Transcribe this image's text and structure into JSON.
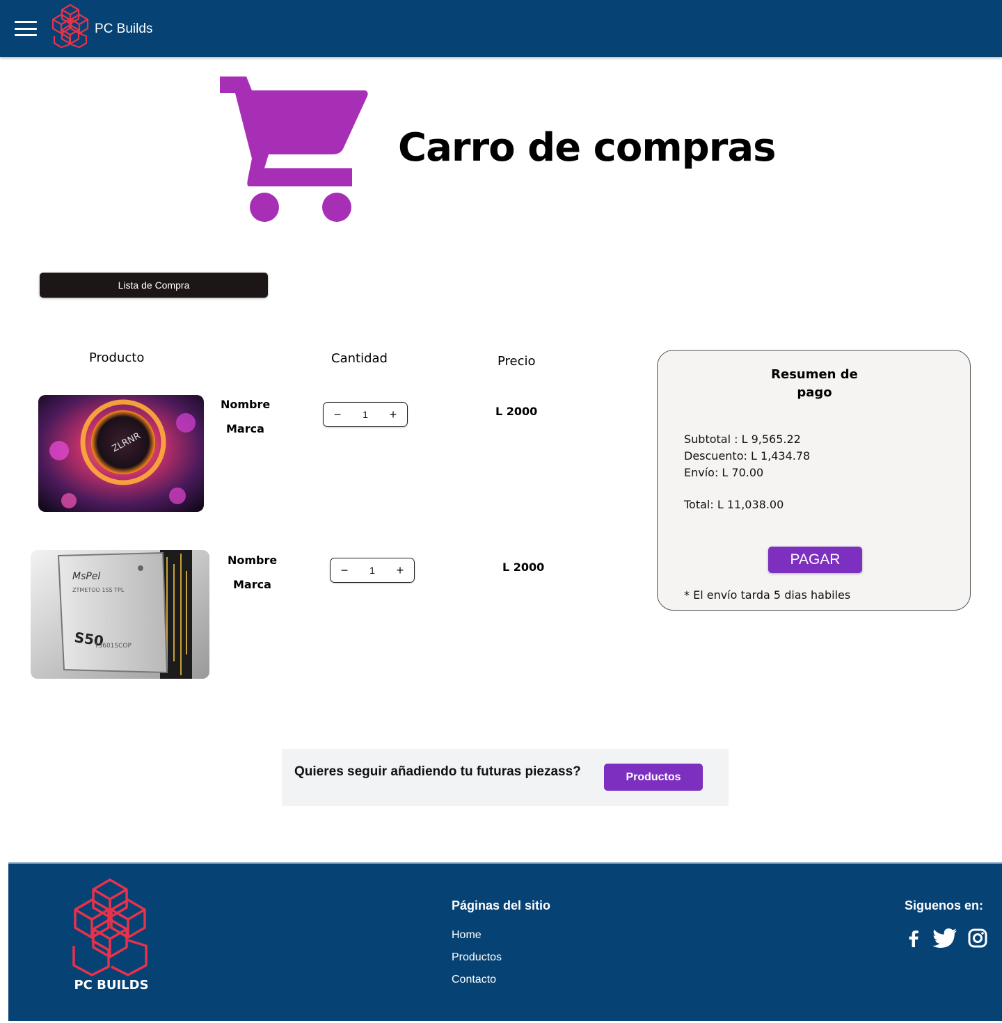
{
  "header": {
    "brand_name": "PC Builds",
    "colors": {
      "bar": "#064273",
      "logo": "#e8324b"
    }
  },
  "hero": {
    "title": "Carro de compras",
    "cart_icon": "shopping-cart-icon",
    "cart_color": "#a72fb6"
  },
  "list_button_label": "Lista de Compra",
  "table": {
    "headers": {
      "product": "Producto",
      "quantity": "Cantidad",
      "price": "Precio"
    },
    "items": [
      {
        "name": "Nombre",
        "brand": "Marca",
        "quantity": "1",
        "price": "L 2000",
        "image": "liquid-cooler-product-image"
      },
      {
        "name": "Nombre",
        "brand": "Marca",
        "quantity": "1",
        "price": "L 2000",
        "image": "ssd-product-image"
      }
    ]
  },
  "summary": {
    "title_line1": "Resumen de",
    "title_line2": "pago",
    "subtotal": "Subtotal : L 9,565.22",
    "discount": "Descuento: L 1,434.78",
    "shipping": "Envío: L 70.00",
    "total": "Total: L 11,038.00",
    "pay_label": "PAGAR",
    "note": "* El envío tarda 5 dias habiles"
  },
  "cta": {
    "text": "Quieres seguir añadiendo tu futuras piezass?",
    "button": "Productos",
    "accent": "#7d2fc0"
  },
  "footer": {
    "logo_text": "PC BUILDS",
    "pages_title": "Páginas del sitio",
    "links": [
      "Home",
      "Productos",
      "Contacto"
    ],
    "follow_title": "Siguenos en:",
    "social_icons": [
      "facebook-icon",
      "twitter-icon",
      "instagram-icon"
    ]
  }
}
